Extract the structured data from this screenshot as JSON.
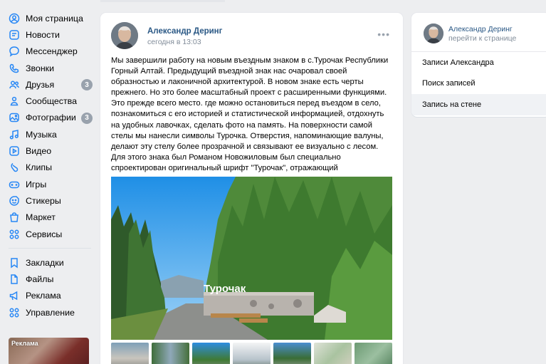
{
  "nav": {
    "items": [
      {
        "label": "Моя страница",
        "icon": "user-circle-icon"
      },
      {
        "label": "Новости",
        "icon": "news-icon"
      },
      {
        "label": "Мессенджер",
        "icon": "chat-bubble-icon"
      },
      {
        "label": "Звонки",
        "icon": "phone-icon"
      },
      {
        "label": "Друзья",
        "icon": "friends-icon",
        "badge": "3"
      },
      {
        "label": "Сообщества",
        "icon": "communities-icon"
      },
      {
        "label": "Фотографии",
        "icon": "photo-icon",
        "badge": "3"
      },
      {
        "label": "Музыка",
        "icon": "music-icon"
      },
      {
        "label": "Видео",
        "icon": "video-icon"
      },
      {
        "label": "Клипы",
        "icon": "clips-icon"
      },
      {
        "label": "Игры",
        "icon": "gamepad-icon"
      },
      {
        "label": "Стикеры",
        "icon": "sticker-icon"
      },
      {
        "label": "Маркет",
        "icon": "market-bag-icon"
      },
      {
        "label": "Сервисы",
        "icon": "services-grid-icon"
      }
    ],
    "secondary": [
      {
        "label": "Закладки",
        "icon": "bookmark-icon"
      },
      {
        "label": "Файлы",
        "icon": "file-icon"
      },
      {
        "label": "Реклама",
        "icon": "megaphone-icon"
      },
      {
        "label": "Управление",
        "icon": "manage-grid-icon"
      }
    ],
    "ad_label": "Реклама"
  },
  "post": {
    "author": "Александр Деринг",
    "date": "сегодня в 13:03",
    "text": "Мы завершили работу на новым въездным знаком в с.Турочак Республики Горный Алтай. Предыдущий въездной знак нас очаровал своей образностью и лаконичной архитектурой. В новом знаке есть черты прежнего. Но это более масштабный проект с расширенными функциями. Это прежде всего место. где можно остановиться перед въездом в село, познакомиться с его историей и статистической информацией, отдохнуть на удобных лавочках, сделать фото на память. На поверхности самой стелы мы нанесли символы Турочка. Отверстия, напоминающие валуны, делают эту стелу более прозрачной и связывают ее визуально с лесом. Для этого знака был Романом Новожиловым был специально спроектирован оригинальный шрифт \"Турочак\", отражающий индивидуальность места.",
    "photo_sign_text": "Турочак"
  },
  "profile_card": {
    "name": "Александр Деринг",
    "goto": "перейти к странице",
    "menu": [
      {
        "label": "Записи Александра",
        "active": false
      },
      {
        "label": "Поиск записей",
        "active": false
      },
      {
        "label": "Запись на стене",
        "active": true
      }
    ]
  },
  "colors": {
    "link": "#2a5885",
    "muted": "#818c99",
    "badge": "#99a2ad",
    "icon": "#2787f5",
    "background": "#edeef0"
  }
}
